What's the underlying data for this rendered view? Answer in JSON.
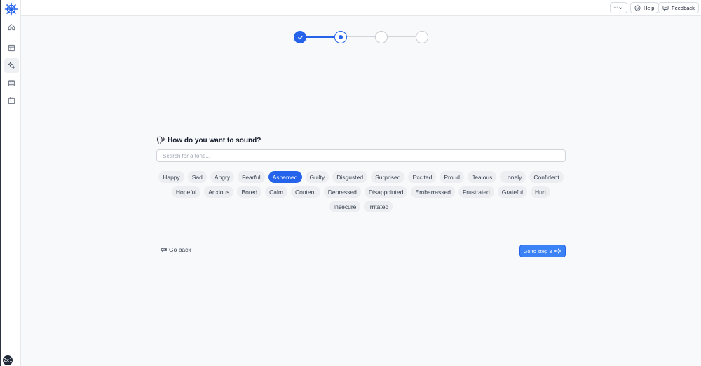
{
  "sidebar": {
    "logo_icon": "ship-wheel-icon",
    "items": [
      {
        "name": "home",
        "icon": "home-icon",
        "active": false
      },
      {
        "name": "layout",
        "icon": "layout-icon",
        "active": false
      },
      {
        "name": "tone",
        "icon": "sparkle-icon",
        "active": true
      },
      {
        "name": "window",
        "icon": "window-icon",
        "active": false
      },
      {
        "name": "calendar",
        "icon": "calendar-icon",
        "active": false
      }
    ],
    "badge": "2x1"
  },
  "topbar": {
    "wave_selector": "〰",
    "help_label": "Help",
    "feedback_label": "Feedback"
  },
  "stepper": {
    "total_steps": 4,
    "current_step": 2
  },
  "main": {
    "question": "How do you want to sound?",
    "search_placeholder": "Search for a tone...",
    "tones": [
      "Happy",
      "Sad",
      "Angry",
      "Fearful",
      "Ashamed",
      "Guilty",
      "Disgusted",
      "Surprised",
      "Excited",
      "Proud",
      "Jealous",
      "Lonely",
      "Confident",
      "Hopeful",
      "Anxious",
      "Bored",
      "Calm",
      "Content",
      "Depressed",
      "Disappointed",
      "Embarrassed",
      "Frustrated",
      "Grateful",
      "Hurt",
      "Insecure",
      "Irritated"
    ],
    "selected_tone": "Ashamed",
    "back_label": "Go back",
    "next_label": "Go to step 3"
  },
  "colors": {
    "accent": "#2563eb",
    "chip": "#eceef1",
    "background": "#f8f9fb"
  }
}
